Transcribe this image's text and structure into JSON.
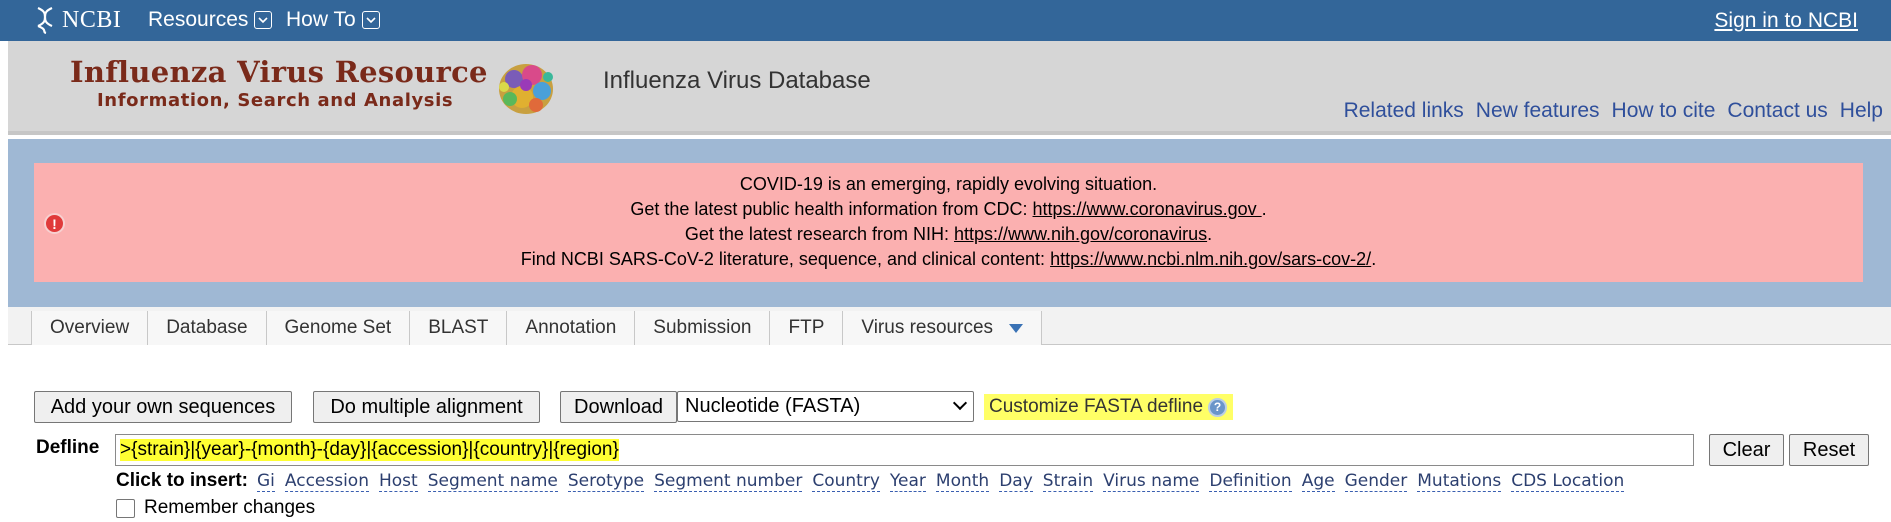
{
  "topbar": {
    "logo_text": "NCBI",
    "menus": [
      "Resources",
      "How To"
    ],
    "signin": "Sign in to NCBI"
  },
  "header": {
    "title": "Influenza Virus Resource",
    "subtitle": "Information, Search and Analysis",
    "database_title": "Influenza Virus Database",
    "links": [
      "Related links",
      "New features",
      "How to cite",
      "Contact us",
      "Help"
    ],
    "link_color": "#2f4f9b"
  },
  "alert": {
    "line1": "COVID-19 is an emerging, rapidly evolving situation.",
    "line2_prefix": "Get the latest public health information from CDC: ",
    "line2_link": "https://www.coronavirus.gov ",
    "line2_suffix": ".",
    "line3_prefix": "Get the latest research from NIH: ",
    "line3_link": "https://www.nih.gov/coronavirus",
    "line3_suffix": ".",
    "line4_prefix": "Find NCBI SARS-CoV-2 literature, sequence, and clinical content: ",
    "line4_link": "https://www.ncbi.nlm.nih.gov/sars-cov-2/",
    "line4_suffix": ".",
    "background": "#fbb0b0"
  },
  "tabs": [
    "Overview",
    "Database",
    "Genome Set",
    "BLAST",
    "Annotation",
    "Submission",
    "FTP",
    "Virus resources"
  ],
  "actions": {
    "add_sequences": "Add your own sequences",
    "multiple_alignment": "Do multiple alignment",
    "download": "Download",
    "format_selected": "Nucleotide (FASTA)",
    "customize_label": "Customize FASTA defline"
  },
  "defline": {
    "label": "Defline",
    "value": ">{strain}|{year}-{month}-{day}|{accession}|{country}|{region}",
    "clear": "Clear",
    "reset": "Reset",
    "insert_label": "Click to insert:",
    "insert_items": [
      "Gi",
      "Accession",
      "Host",
      "Segment name",
      "Serotype",
      "Segment number",
      "Country",
      "Year",
      "Month",
      "Day",
      "Strain",
      "Virus name",
      "Definition",
      "Age",
      "Gender",
      "Mutations",
      "CDS Location"
    ],
    "remember_label": "Remember changes"
  },
  "colors": {
    "topbar": "#336699",
    "highlight": "#ffff66",
    "band": "#9fb8d4"
  }
}
